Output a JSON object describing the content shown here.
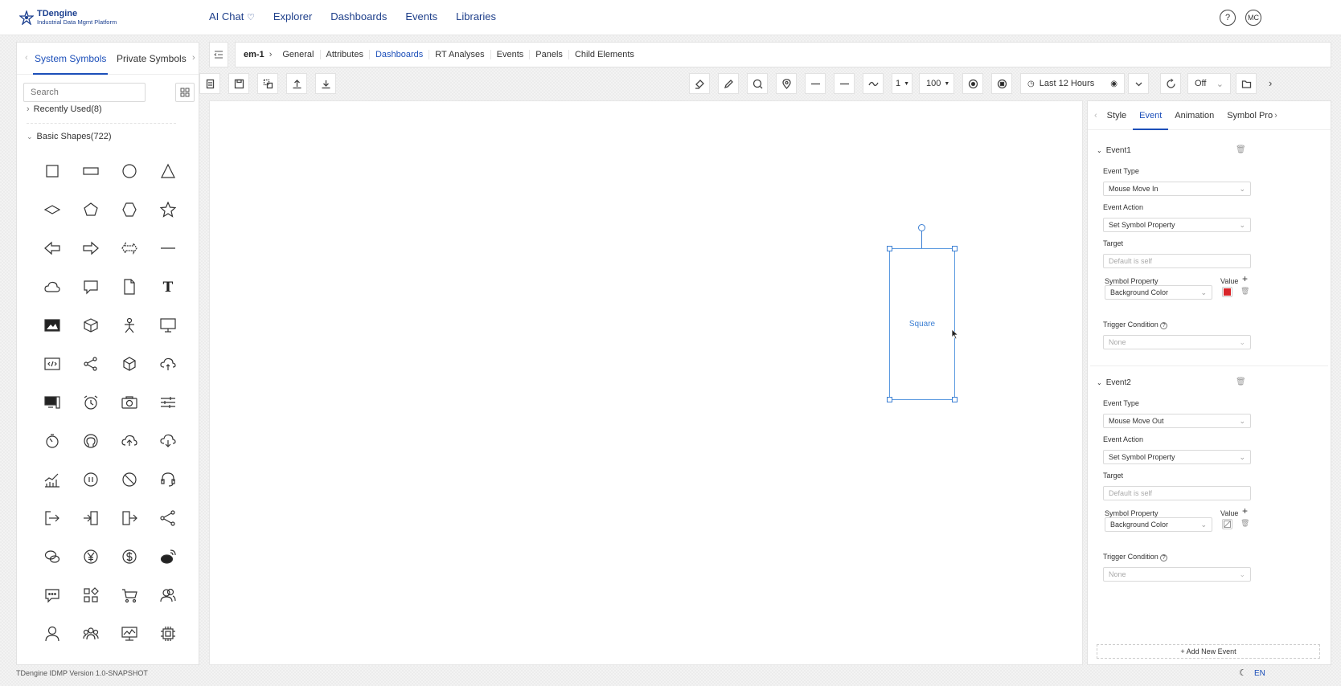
{
  "app": {
    "name": "TDengine",
    "subtitle": "Industrial Data Mgmt Platform",
    "version": "TDengine IDMP Version 1.0-SNAPSHOT",
    "language": "EN",
    "user_initials": "MC",
    "accent_color": "#1c4fb9"
  },
  "nav": {
    "items": [
      "AI Chat",
      "Explorer",
      "Dashboards",
      "Events",
      "Libraries"
    ]
  },
  "left_panel": {
    "tabs": [
      "System Symbols",
      "Private Symbols"
    ],
    "active_tab": "System Symbols",
    "search_placeholder": "Search",
    "groups": [
      {
        "label": "Recently Used(8)",
        "expanded": false
      },
      {
        "label": "Basic Shapes(722)",
        "expanded": true
      }
    ],
    "icons": [
      "square-icon",
      "rectangle-icon",
      "circle-icon",
      "triangle-icon",
      "diamond-icon",
      "pentagon-icon",
      "hexagon-icon",
      "star-icon",
      "arrow-left-icon",
      "arrow-right-icon",
      "double-arrow-icon",
      "line-icon",
      "cloud-icon",
      "speech-bubble-icon",
      "document-icon",
      "text-icon",
      "image-icon",
      "cube-icon",
      "person-icon",
      "monitor-icon",
      "code-window-icon",
      "share-icon",
      "box-3d-icon",
      "cloud-upload-icon",
      "computer-icon",
      "alarm-clock-icon",
      "camera-icon",
      "sliders-icon",
      "timer-icon",
      "github-icon",
      "cloud-up-arrow-icon",
      "cloud-down-arrow-icon",
      "stock-chart-icon",
      "pause-icon",
      "forbidden-icon",
      "headset-icon",
      "logout-icon",
      "door-enter-icon",
      "door-exit-icon",
      "share-nodes-icon",
      "wechat-icon",
      "yen-icon",
      "dollar-icon",
      "weibo-icon",
      "chat-dots-icon",
      "apps-icon",
      "cart-icon",
      "users-icon",
      "user-icon",
      "group-icon",
      "monitor-chart-icon",
      "chip-icon"
    ]
  },
  "breadcrumb": {
    "root": "em-1",
    "tabs": [
      "General",
      "Attributes",
      "Dashboards",
      "RT Analyses",
      "Events",
      "Panels",
      "Child Elements"
    ],
    "active_tab": "Dashboards"
  },
  "toolbar": {
    "stroke_width": "1",
    "zoom": "100",
    "time_range": "Last 12 Hours",
    "refresh": "Off"
  },
  "canvas": {
    "shape_label": "Square"
  },
  "right_panel": {
    "tabs": [
      "Style",
      "Event",
      "Animation",
      "Symbol Pro"
    ],
    "active_tab": "Event",
    "labels": {
      "event_type": "Event Type",
      "event_action": "Event Action",
      "target": "Target",
      "symbol_property": "Symbol Property",
      "value": "Value",
      "trigger_condition": "Trigger Condition"
    },
    "events": [
      {
        "name": "Event1",
        "event_type": "Mouse Move In",
        "event_action": "Set Symbol Property",
        "target_placeholder": "Default is self",
        "symbol_property": "Background Color",
        "value_color": "#d9262a",
        "trigger_condition": "None"
      },
      {
        "name": "Event2",
        "event_type": "Mouse Move Out",
        "event_action": "Set Symbol Property",
        "target_placeholder": "Default is self",
        "symbol_property": "Background Color",
        "value_color": "",
        "trigger_condition": "None"
      }
    ],
    "add_event_label": "+ Add New Event"
  }
}
